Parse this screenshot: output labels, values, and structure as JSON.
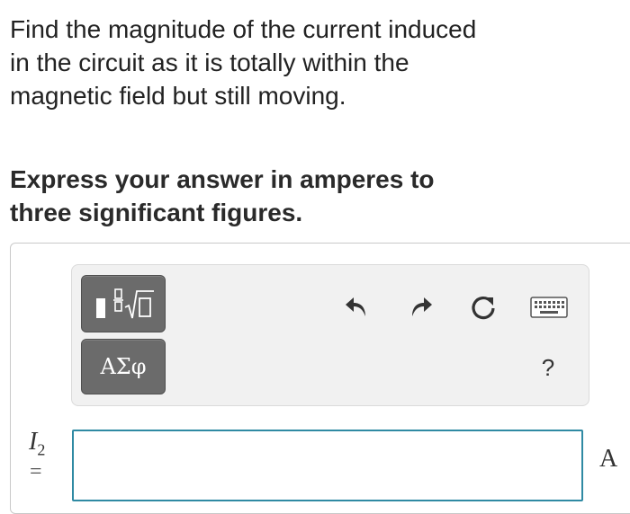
{
  "question": {
    "text": "Find the magnitude of the current induced in the circuit as it is totally within the magnetic field but still moving.",
    "instruction": "Express your answer in amperes to three significant figures."
  },
  "toolbar": {
    "templates_icon": "fraction-root-template-icon",
    "symbols_label": "ΑΣφ",
    "undo_icon": "undo-icon",
    "redo_icon": "redo-icon",
    "reset_icon": "reset-icon",
    "keyboard_icon": "keyboard-icon",
    "help_label": "?"
  },
  "answer": {
    "variable": "I",
    "subscript": "2",
    "equals": "=",
    "value": "",
    "unit": "A"
  },
  "colors": {
    "text": "#222222",
    "button_bg": "#6b6b6b",
    "toolbar_bg": "#f1f1f1",
    "input_border": "#2f8aa3"
  }
}
